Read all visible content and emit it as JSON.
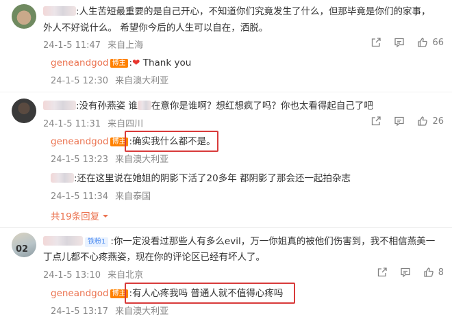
{
  "comments": [
    {
      "text_line1": ":人生苦短最重要的是自己开心，不知道你们究竟发生了什么，但那毕竟是你们的家事，",
      "text_line2": "外人不好说什么。 希望你今后的人生可以自在，洒脱。",
      "date": "24-1-5 11:47",
      "location": "来自上海",
      "likes": "66",
      "reply": {
        "author": "geneandgod",
        "badge": "博主",
        "text": ":",
        "emoji": "❤",
        "text_after": " Thank you",
        "date": "24-1-5 12:30",
        "location": "来自澳大利亚"
      }
    },
    {
      "text_a": ":没有孙燕姿 谁",
      "text_b": "在意你是谁啊？想红想疯了吗？你也太看得起自己了吧",
      "date": "24-1-5 11:31",
      "location": "来自四川",
      "likes": "26",
      "reply": {
        "author": "geneandgod",
        "badge": "博主",
        "text": ":确实我什么都不是。",
        "date": "24-1-5 13:23",
        "location": "来自澳大利亚"
      },
      "reply2": {
        "text": ":还在这里说在她姐的阴影下活了20多年 都阴影了那会还一起拍杂志",
        "date": "24-1-5 11:34",
        "location": "来自泰国"
      },
      "more": "共19条回复"
    },
    {
      "fan_badge": "铁粉1",
      "text_line1": ":你一定没看过那些人有多么evil，万一你姐真的被他们伤害到，我不相信燕美一",
      "text_line2": "丁点儿都不心疼燕姿，现在你的评论区已经有坏人了。",
      "date": "24-1-5 13:10",
      "location": "来自北京",
      "likes": "8",
      "reply": {
        "author": "geneandgod",
        "badge": "博主",
        "text": ":有人心疼我吗 普通人就不值得心疼吗",
        "date": "24-1-5 13:17",
        "location": "来自澳大利亚"
      }
    }
  ],
  "icons": [
    "share-icon",
    "comment-icon",
    "like-icon",
    "chevron-down-icon"
  ],
  "colors": {
    "username": "#eb7350",
    "host_badge": "#ff8200",
    "highlight_box": "#d83a3a"
  }
}
